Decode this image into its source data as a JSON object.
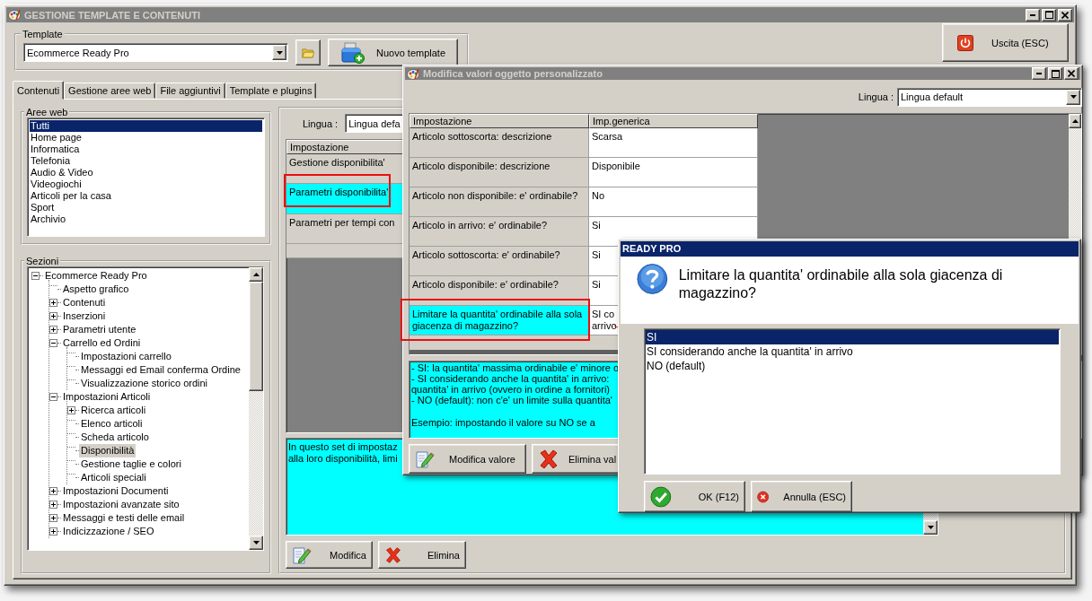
{
  "main_window": {
    "title": "GESTIONE TEMPLATE E CONTENUTI",
    "active": false
  },
  "template": {
    "label": "Template",
    "value": "Ecommerce Ready Pro",
    "new_button": "Nuovo template"
  },
  "exit_button": "Uscita (ESC)",
  "tabs": [
    {
      "label": "Contenuti",
      "selected": true
    },
    {
      "label": "Gestione aree web",
      "selected": false
    },
    {
      "label": "File aggiuntivi",
      "selected": false
    },
    {
      "label": "Template e plugins",
      "selected": false
    }
  ],
  "web_areas": {
    "label": "Aree web",
    "items": [
      {
        "label": "Tutti",
        "selected": true
      },
      {
        "label": "Home page",
        "selected": false
      },
      {
        "label": "Informatica",
        "selected": false
      },
      {
        "label": "Telefonia",
        "selected": false
      },
      {
        "label": "Audio & Video",
        "selected": false
      },
      {
        "label": "Videogiochi",
        "selected": false
      },
      {
        "label": "Articoli per la casa",
        "selected": false
      },
      {
        "label": "Sport",
        "selected": false
      },
      {
        "label": "Archivio",
        "selected": false
      }
    ]
  },
  "sections": {
    "label": "Sezioni",
    "tree": [
      {
        "label": "Ecommerce Ready Pro",
        "selected": false,
        "expanded": true,
        "children": [
          {
            "label": "Aspetto grafico",
            "selected": false
          },
          {
            "label": "Contenuti",
            "selected": false,
            "expanded": false
          },
          {
            "label": "Inserzioni",
            "selected": false,
            "expanded": false
          },
          {
            "label": "Parametri utente",
            "selected": false,
            "expanded": false
          },
          {
            "label": "Carrello ed Ordini",
            "selected": false,
            "expanded": true,
            "children": [
              {
                "label": "Impostazioni carrello",
                "selected": false
              },
              {
                "label": "Messaggi ed Email conferma Ordine",
                "selected": false
              },
              {
                "label": "Visualizzazione storico ordini",
                "selected": false
              }
            ]
          },
          {
            "label": "Impostazioni Articoli",
            "selected": false,
            "expanded": true,
            "children": [
              {
                "label": "Ricerca articoli",
                "selected": false,
                "expanded": false
              },
              {
                "label": "Elenco articoli",
                "selected": false
              },
              {
                "label": "Scheda articolo",
                "selected": false
              },
              {
                "label": "Disponibilità",
                "selected": true
              },
              {
                "label": "Gestione taglie e colori",
                "selected": false
              },
              {
                "label": "Articoli speciali",
                "selected": false
              }
            ]
          },
          {
            "label": "Impostazioni Documenti",
            "selected": false,
            "expanded": false
          },
          {
            "label": "Impostazioni avanzate sito",
            "selected": false,
            "expanded": false
          },
          {
            "label": "Messaggi e testi delle email",
            "selected": false,
            "expanded": false
          },
          {
            "label": "Indicizzazione / SEO",
            "selected": false,
            "expanded": false
          }
        ]
      }
    ]
  },
  "content_panel": {
    "language_label": "Lingua :",
    "language_value": "Lingua defa",
    "grid_header": "Impostazione",
    "rows": [
      {
        "setting": "Gestione disponibilita'",
        "selected": false
      },
      {
        "setting": "Parametri disponibilita'",
        "selected": true
      },
      {
        "setting": "Parametri per tempi con",
        "selected": false
      }
    ],
    "description": [
      "In questo set di impostaz",
      "alla loro disponibilità, limi"
    ],
    "buttons": [
      {
        "label": "Modifica",
        "kind": "edit"
      },
      {
        "label": "Elimina",
        "kind": "delete"
      }
    ]
  },
  "edit_dialog": {
    "title": "Modifica valori oggetto personalizzato",
    "active": false,
    "language_label": "Lingua :",
    "language_value": "Lingua default",
    "columns": [
      "Impostazione",
      "Imp.generica"
    ],
    "rows": [
      {
        "setting": "Articolo sottoscorta: descrizione",
        "value": "Scarsa",
        "selected": false
      },
      {
        "setting": "Articolo disponibile: descrizione",
        "value": "Disponibile",
        "selected": false
      },
      {
        "setting": "Articolo non disponibile: e' ordinabile?",
        "value": "No",
        "selected": false
      },
      {
        "setting": "Articolo in arrivo: e' ordinabile?",
        "value": "Si",
        "selected": false
      },
      {
        "setting": "Articolo sottoscorta: e' ordinabile?",
        "value": "Si",
        "selected": false
      },
      {
        "setting": "Articolo disponibile: e' ordinabile?",
        "value": "Si",
        "selected": false
      },
      {
        "setting": "Limitare la quantita' ordinabile alla sola giacenza di magazzino?",
        "value": "SI co\narrivo",
        "selected": true
      }
    ],
    "description": [
      [
        "- SI: la quantita' massima ordinabile e' minore o",
        "- SI considerando anche la quantita' in arrivo:",
        "quantita' in arrivo (ovvero in ordine a fornitori)",
        "- NO (default): non c'e' un limite sulla quantita'"
      ],
      [
        "Esempio: impostando il valore su NO se a"
      ]
    ],
    "buttons": [
      {
        "label": "Modifica valore",
        "kind": "edit"
      },
      {
        "label": "Elimina val",
        "kind": "delete"
      }
    ]
  },
  "confirm_dialog": {
    "title": "READY PRO",
    "active": true,
    "question": "Limitare la quantita' ordinabile alla sola giacenza di magazzino?",
    "options": [
      {
        "label": "SI",
        "selected": true
      },
      {
        "label": "SI considerando anche la quantita' in arrivo",
        "selected": false
      },
      {
        "label": "NO (default)",
        "selected": false
      }
    ],
    "buttons": [
      {
        "label": "OK (F12)",
        "kind": "ok"
      },
      {
        "label": "Annulla (ESC)",
        "kind": "cancel"
      }
    ]
  }
}
